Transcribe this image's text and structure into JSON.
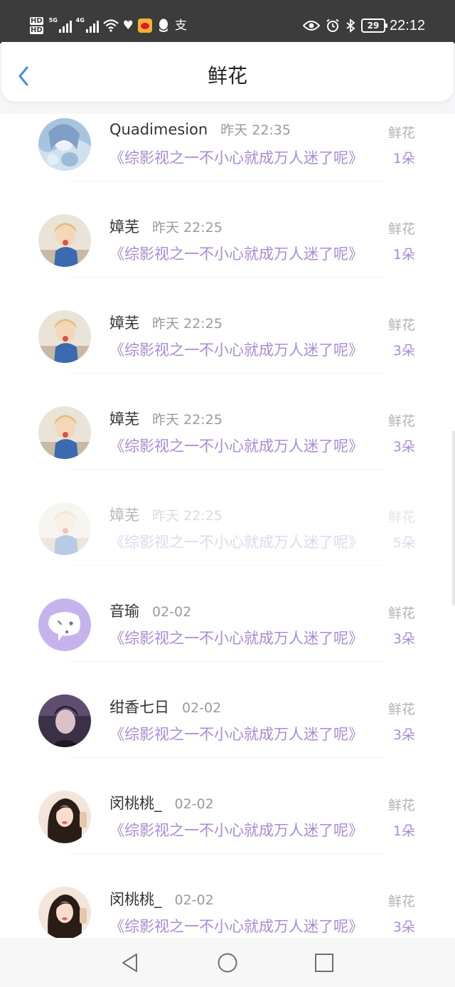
{
  "status_bar": {
    "hd1": "HD",
    "hd2": "HD",
    "net1": "5G",
    "net2": "4G",
    "battery": "29",
    "time": "22:12",
    "icons": [
      "signal-icon",
      "wifi-icon",
      "health-icon",
      "weibo-icon",
      "qq-icon",
      "alipay-icon",
      "eye-icon",
      "alarm-icon",
      "bluetooth-icon",
      "battery-icon"
    ]
  },
  "header": {
    "title": "鲜花",
    "back_icon": "chevron-left-icon"
  },
  "colors": {
    "accent": "#a98bd3",
    "back": "#3f8fe0",
    "status_bar_bg": "#3c3c3c"
  },
  "items": [
    {
      "name": "Quadimesion",
      "time": "昨天 22:35",
      "book": "《综影视之一不小心就成万人迷了呢》",
      "label": "鲜花",
      "count": "1朵",
      "avatar": "anime-avatar"
    },
    {
      "name": "嫜芜",
      "time": "昨天 22:25",
      "book": "《综影视之一不小心就成万人迷了呢》",
      "label": "鲜花",
      "count": "1朵",
      "avatar": "child-avatar"
    },
    {
      "name": "嫜芜",
      "time": "昨天 22:25",
      "book": "《综影视之一不小心就成万人迷了呢》",
      "label": "鲜花",
      "count": "3朵",
      "avatar": "child-avatar"
    },
    {
      "name": "嫜芜",
      "time": "昨天 22:25",
      "book": "《综影视之一不小心就成万人迷了呢》",
      "label": "鲜花",
      "count": "3朵",
      "avatar": "child-avatar"
    },
    {
      "name": "嫜芜",
      "time": "昨天 22:25",
      "book": "《综影视之一不小心就成万人迷了呢》",
      "label": "鲜花",
      "count": "5朵",
      "avatar": "child-avatar"
    },
    {
      "name": "音瑜",
      "time": "02-02",
      "book": "《综影视之一不小心就成万人迷了呢》",
      "label": "鲜花",
      "count": "3朵",
      "avatar": "default-chat-avatar"
    },
    {
      "name": "绀香七日",
      "time": "02-02",
      "book": "《综影视之一不小心就成万人迷了呢》",
      "label": "鲜花",
      "count": "3朵",
      "avatar": "man-avatar"
    },
    {
      "name": "闵桃桃_",
      "time": "02-02",
      "book": "《综影视之一不小心就成万人迷了呢》",
      "label": "鲜花",
      "count": "1朵",
      "avatar": "woman-avatar"
    },
    {
      "name": "闵桃桃_",
      "time": "02-02",
      "book": "《综影视之一不小心就成万人迷了呢》",
      "label": "鲜花",
      "count": "3朵",
      "avatar": "woman-avatar"
    }
  ],
  "nav": {
    "back": "nav-back-icon",
    "home": "nav-home-icon",
    "recent": "nav-recent-icon"
  }
}
